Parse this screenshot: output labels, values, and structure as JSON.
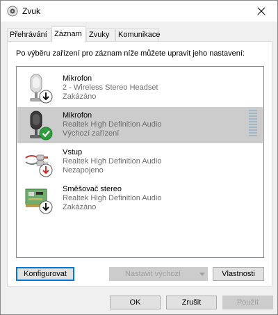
{
  "window": {
    "title": "Zvuk"
  },
  "tabs": [
    {
      "label": "Přehrávání",
      "active": false
    },
    {
      "label": "Záznam",
      "active": true
    },
    {
      "label": "Zvuky",
      "active": false
    },
    {
      "label": "Komunikace",
      "active": false
    }
  ],
  "instruction": "Po výběru zařízení pro záznam níže můžete upravit jeho nastavení:",
  "devices": [
    {
      "name": "Mikrofon",
      "driver": "2 - Wireless Stereo Headset",
      "status": "Zakázáno",
      "icon": "microphone-disabled-icon",
      "selected": false
    },
    {
      "name": "Mikrofon",
      "driver": "Realtek High Definition Audio",
      "status": "Výchozí zařízení",
      "icon": "microphone-default-icon",
      "selected": true
    },
    {
      "name": "Vstup",
      "driver": "Realtek High Definition Audio",
      "status": "Nezapojeno",
      "icon": "line-in-unplugged-icon",
      "selected": false
    },
    {
      "name": "Směšovač stereo",
      "driver": "Realtek High Definition Audio",
      "status": "Zakázáno",
      "icon": "stereo-mix-disabled-icon",
      "selected": false
    }
  ],
  "buttons": {
    "configure": "Konfigurovat",
    "set_default": "Nastavit výchozí",
    "properties": "Vlastnosti",
    "ok": "OK",
    "cancel": "Zrušit",
    "apply": "Použít"
  },
  "colors": {
    "selection": "#cccccc",
    "focus_border": "#0078d7",
    "status_green": "#2e9e3f",
    "status_red": "#d62b2b"
  }
}
